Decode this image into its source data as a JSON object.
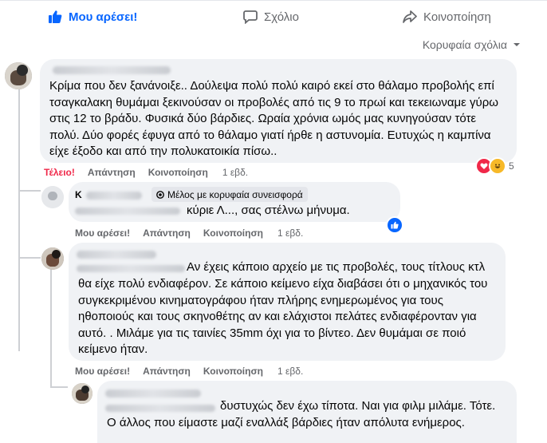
{
  "actions": {
    "like": "Μου αρέσει!",
    "comment": "Σχόλιο",
    "share": "Κοινοποίηση"
  },
  "sort": {
    "label": "Κορυφαία σχόλια"
  },
  "comments": [
    {
      "text": "Κρίμα που δεν ξανάνοιξε.. Δούλεψα πολύ πολύ καιρό εκεί στο θάλαμο προβολής επί τσαγκαλακη θυμάμαι ξεκινούσαν οι προβολές από τις 9 το πρωί και τεκειωναμε γύρω στις 12 το βράδυ. Φυσικά δύο βάρδιες. Ωραία χρόνια ωμός μας κυνηγούσαν τότε πολύ. Δύο φορές έφυγα από το θάλαμο γιατί ήρθε η αστυνομία. Ευτυχώς η καμπίνα είχε έξοδο και από την πολυκατοικία πίσω..",
      "reaction_label": "Τέλειο!",
      "reply": "Απάντηση",
      "share": "Κοινοποίηση",
      "time": "1 εβδ.",
      "reaction_count": "5"
    },
    {
      "name_initial": "Κ",
      "badge": "Μέλος με κορυφαία συνεισφορά",
      "text": "κύριε Λ..., σας στέλνω μήνυμα.",
      "like": "Μου αρέσει!",
      "reply": "Απάντηση",
      "share": "Κοινοποίηση",
      "time": "1 εβδ."
    },
    {
      "text_first": "Αν έχεις κάποιο αρχείο με τις προβολές, τους τίτλους κτλ",
      "text_rest": "θα είχε πολύ ενδιαφέρον. Σε κάποιο κείμενο είχα διαβάσει ότι ο μηχανικός του συγκεκριμένου κινηματογράφου ήταν πλήρης ενημερωμένος για τους ηθοποιούς και τους σκηνοθέτης αν και ελάχιστοι πελάτες ενδιαφέρονταν για αυτό. . Μιλάμε για τις ταινίες 35mm όχι για το βίντεο. Δεν θυμάμαι σε ποιό κείμενο ήταν.",
      "like": "Μου αρέσει!",
      "reply": "Απάντηση",
      "share": "Κοινοποίηση",
      "time": "1 εβδ."
    },
    {
      "text_first": "δυστυχώς δεν έχω τίποτα. Ναι για φιλμ μιλάμε. Τότε.",
      "text_rest": "Ο άλλος που είμαστε μαζί εναλλάξ βάρδιες ήταν απόλυτα ενήμερος."
    }
  ],
  "colors": {
    "accent": "#0866ff",
    "muted": "#65676b",
    "bubble": "#f0f2f5",
    "love": "#f02849"
  }
}
